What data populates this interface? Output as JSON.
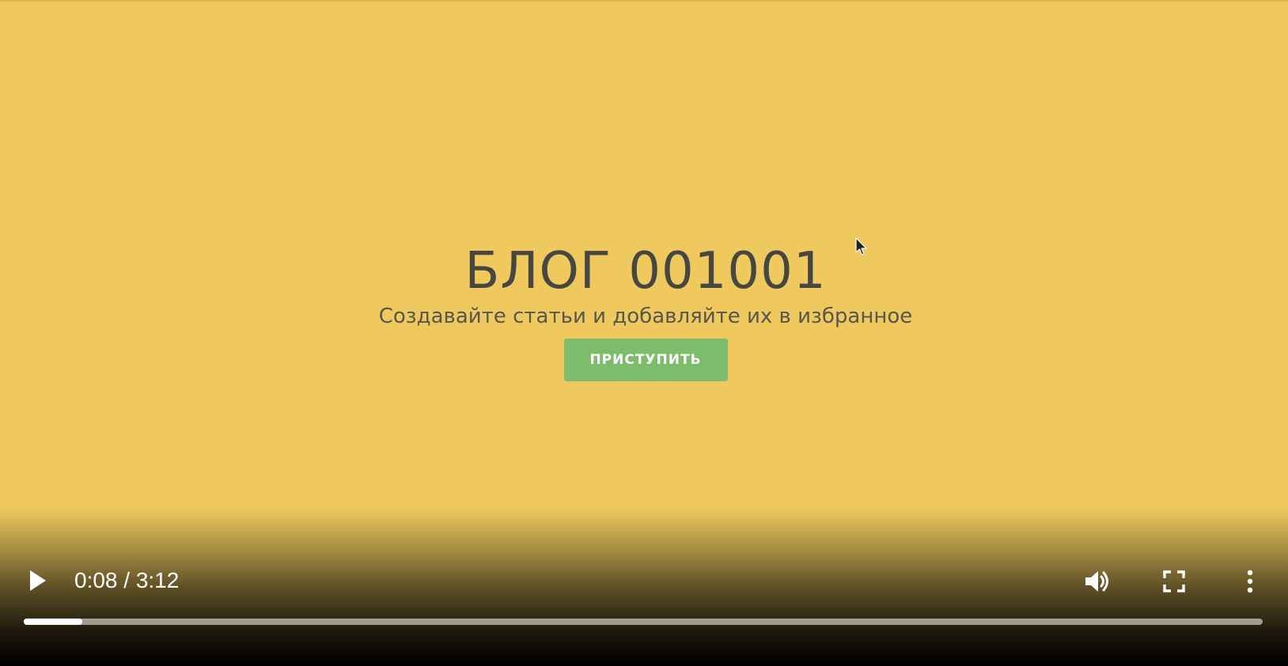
{
  "video": {
    "hero_title": "БЛОГ 001001",
    "hero_subtitle": "Создавайте статьи и добавляйте их в избранное",
    "cta_label": "ПРИСТУПИТЬ",
    "background_color": "#f0c95e",
    "cta_color": "#7dbc6a"
  },
  "controls": {
    "play_icon": "play-icon",
    "time_display": "0:08 / 3:12",
    "current_time": "0:08",
    "duration": "3:12",
    "progress_fraction": 0.047,
    "volume_icon": "volume-icon",
    "fullscreen_icon": "fullscreen-icon",
    "more_icon": "more-options-icon"
  }
}
